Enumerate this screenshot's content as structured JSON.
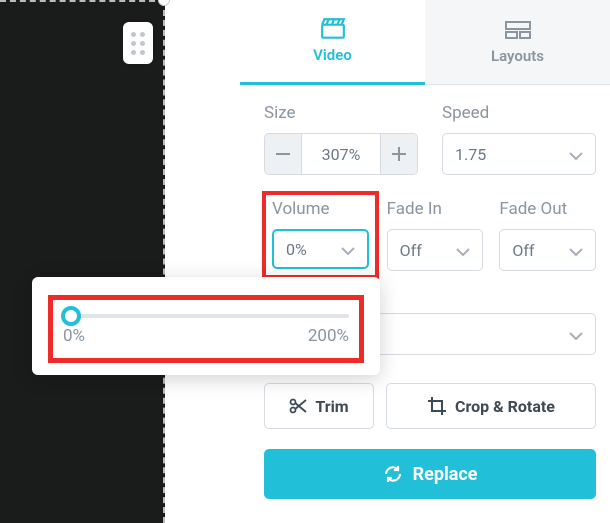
{
  "tabs": {
    "video": "Video",
    "layouts": "Layouts"
  },
  "fields": {
    "size_label": "Size",
    "size_value": "307%",
    "speed_label": "Speed",
    "speed_value": "1.75",
    "volume_label": "Volume",
    "volume_value": "0%",
    "fadein_label": "Fade In",
    "fadein_value": "Off",
    "fadeout_label": "Fade Out",
    "fadeout_value": "Off"
  },
  "slider": {
    "min_label": "0%",
    "max_label": "200%"
  },
  "buttons": {
    "trim": "Trim",
    "crop": "Crop & Rotate",
    "replace": "Replace"
  }
}
